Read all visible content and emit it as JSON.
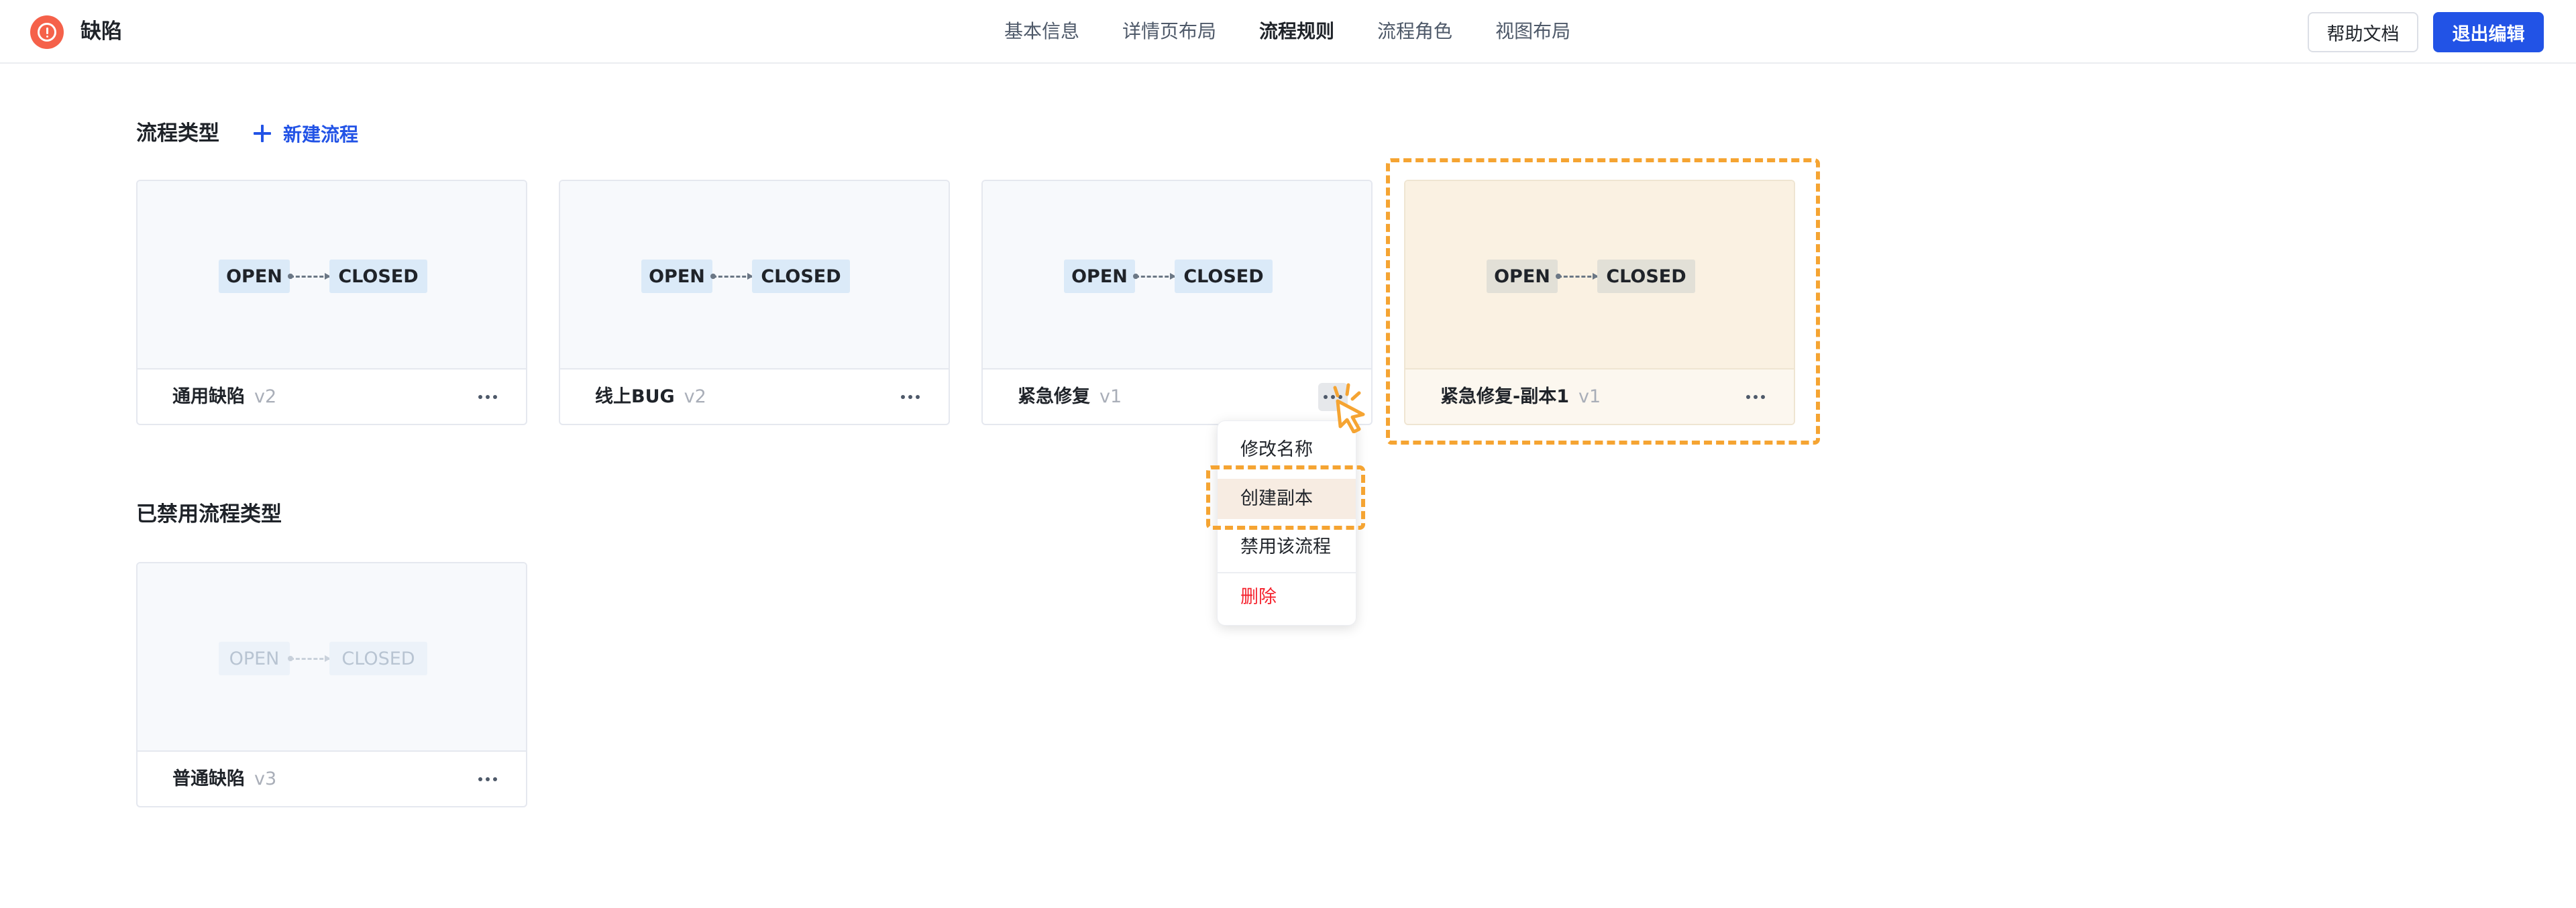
{
  "header": {
    "app_title": "缺陷",
    "tabs": [
      {
        "label": "基本信息",
        "active": false
      },
      {
        "label": "详情页布局",
        "active": false
      },
      {
        "label": "流程规则",
        "active": true
      },
      {
        "label": "流程角色",
        "active": false
      },
      {
        "label": "视图布局",
        "active": false
      }
    ],
    "help_label": "帮助文档",
    "exit_label": "退出编辑",
    "accent_color": "#2253e6"
  },
  "sections": {
    "active_title": "流程类型",
    "new_flow_label": "新建流程",
    "disabled_title": "已禁用流程类型"
  },
  "flow_states": {
    "open": "OPEN",
    "closed": "CLOSED"
  },
  "cards": [
    {
      "name": "通用缺陷",
      "version": "v2"
    },
    {
      "name": "线上BUG",
      "version": "v2"
    },
    {
      "name": "紧急修复",
      "version": "v1"
    },
    {
      "name": "紧急修复-副本1",
      "version": "v1"
    }
  ],
  "disabled_cards": [
    {
      "name": "普通缺陷",
      "version": "v3"
    }
  ],
  "context_menu": {
    "items": [
      {
        "label": "修改名称"
      },
      {
        "label": "创建副本",
        "hovered": true
      },
      {
        "label": "禁用该流程"
      },
      {
        "label": "删除",
        "danger": true
      }
    ]
  },
  "highlight_color": "#f5a432"
}
